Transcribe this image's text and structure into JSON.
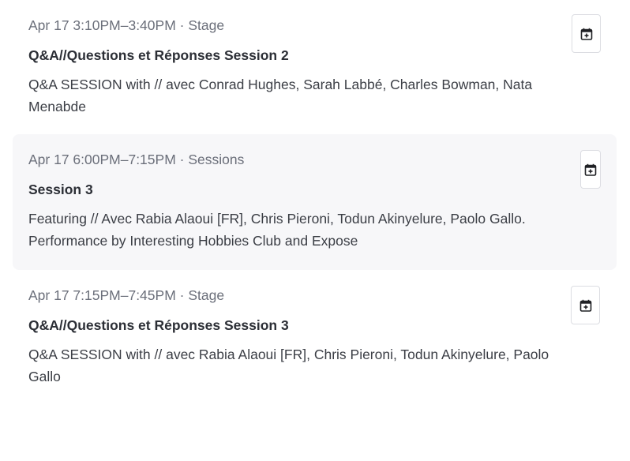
{
  "events": [
    {
      "time": "Apr 17 3:10PM–3:40PM · Stage",
      "title": "Q&A//Questions et Réponses Session 2",
      "description": "Q&A SESSION with // avec Conrad Hughes, Sarah Labbé, Charles Bowman, Nata Menabde",
      "action_icon": "calendar-add-icon"
    },
    {
      "time": "Apr 17 6:00PM–7:15PM · Sessions",
      "title": "Session 3",
      "description": "Featuring // Avec Rabia Alaoui [FR], Chris Pieroni, Todun Akinyelure, Paolo Gallo. Performance by Interesting Hobbies Club and Expose",
      "action_icon": "calendar-add-icon"
    },
    {
      "time": "Apr 17 7:15PM–7:45PM · Stage",
      "title": "Q&A//Questions et Réponses Session 3",
      "description": "Q&A SESSION with // avec Rabia Alaoui [FR], Chris Pieroni, Todun Akinyelure, Paolo Gallo",
      "action_icon": "calendar-add-icon"
    }
  ],
  "colors": {
    "highlight_background": "#f7f7f9",
    "time_text": "#6b6f7a",
    "title_text": "#2c2f36",
    "body_text": "#3b3e45",
    "button_border": "#dcdde2"
  }
}
